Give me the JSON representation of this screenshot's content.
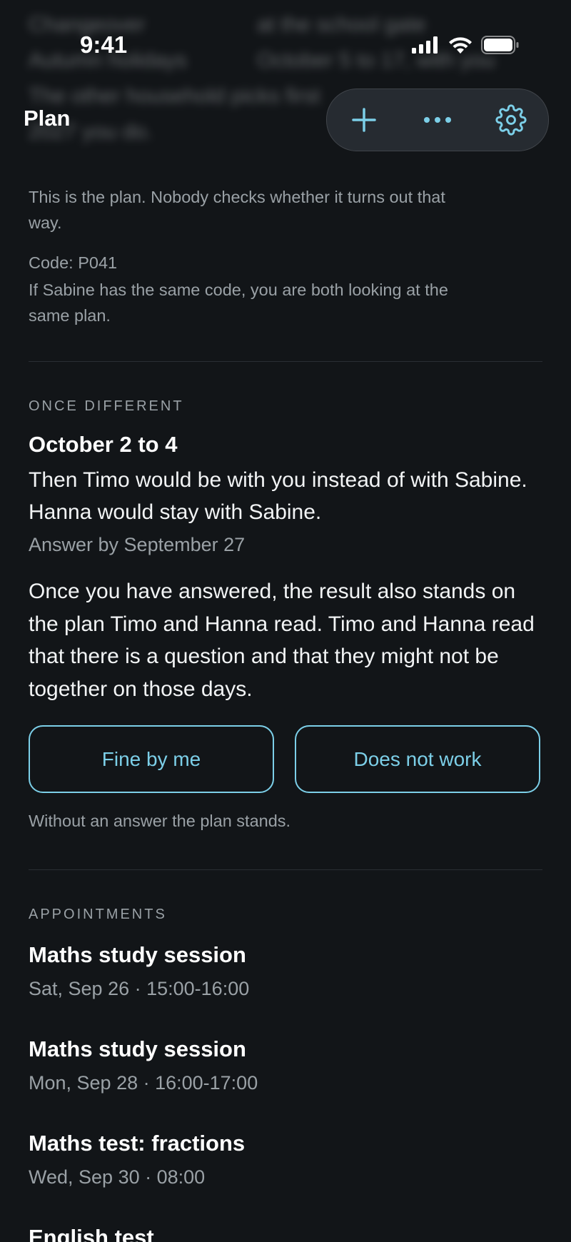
{
  "status_bar": {
    "time": "9:41"
  },
  "behind_text": [
    [
      "Changeover",
      "at the school gate"
    ],
    [
      "Autumn holidays",
      "October 5 to 17, with you"
    ],
    [
      "The other household picks first",
      ""
    ],
    [
      "2027 you do.",
      ""
    ]
  ],
  "nav": {
    "title": "Plan",
    "add_icon": "plus-icon",
    "more_icon": "more-dots-icon",
    "settings_icon": "gear-icon"
  },
  "intro": {
    "disclaimer": "This is the plan. Nobody checks whether it turns out that way.",
    "code_label": "Code: P041",
    "code_note": "If Sabine has the same code, you are both looking at the same plan."
  },
  "once_different": {
    "section_label": "ONCE DIFFERENT",
    "title": "October 2 to 4",
    "body": "Then Timo would be with you instead of with Sabine. Hanna would stay with Sabine.",
    "deadline": "Answer by September 27",
    "explanation": "Once you have answered, the result also stands on the plan Timo and Hanna read. Timo and Hanna read that there is a question and that they might not be together on those days.",
    "accept_label": "Fine by me",
    "decline_label": "Does not work",
    "no_answer_note": "Without an answer the plan stands."
  },
  "appointments": {
    "section_label": "APPOINTMENTS",
    "items": [
      {
        "title": "Maths study session",
        "when": "Sat, Sep 26 · 15:00-16:00"
      },
      {
        "title": "Maths study session",
        "when": "Mon, Sep 28 · 16:00-17:00"
      },
      {
        "title": "Maths test: fractions",
        "when": "Wed, Sep 30 · 08:00"
      },
      {
        "title": "English test",
        "when": ""
      }
    ]
  },
  "colors": {
    "background": "#121518",
    "accent": "#7ccfe8",
    "muted_text": "#9aa1a6",
    "divider": "#2a2f34"
  }
}
